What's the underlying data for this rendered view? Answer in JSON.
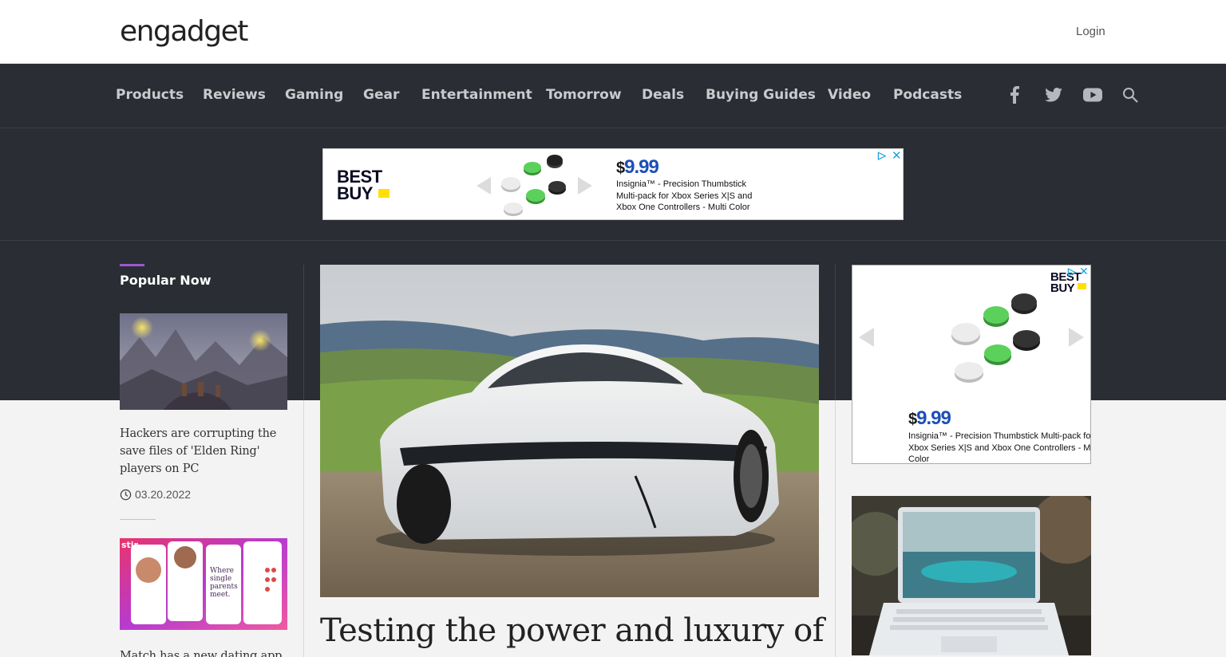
{
  "header": {
    "logo": "engadget",
    "login_label": "Login"
  },
  "nav": {
    "items": [
      {
        "label": "Products"
      },
      {
        "label": "Reviews"
      },
      {
        "label": "Gaming"
      },
      {
        "label": "Gear"
      },
      {
        "label": "Entertainment"
      },
      {
        "label": "Tomorrow"
      },
      {
        "label": "Deals"
      },
      {
        "label": "Buying Guides"
      },
      {
        "label": "Video"
      },
      {
        "label": "Podcasts"
      }
    ],
    "social_icons": [
      "facebook-icon",
      "twitter-icon",
      "youtube-icon",
      "search-icon"
    ]
  },
  "ad_banner": {
    "brand_line1": "BEST",
    "brand_line2": "BUY",
    "price_symbol": "$",
    "price_value": "9.99",
    "description_line1": "Insignia™ - Precision Thumbstick",
    "description_line2": "Multi-pack for Xbox Series X|S and",
    "description_line3": "Xbox One Controllers - Multi Color"
  },
  "ad_side": {
    "brand_line1": "BEST",
    "brand_line2": "BUY",
    "price_symbol": "$",
    "price_value": "9.99",
    "description_line1": "Insignia™ - Precision Thumbstick Multi-pack for",
    "description_line2": "Xbox Series X|S and Xbox One Controllers - Multi",
    "description_line3": "Color"
  },
  "popular": {
    "title": "Popular Now",
    "articles": [
      {
        "title_line1": "Hackers are corrupting the",
        "title_line2": "save files of 'Elden Ring'",
        "title_line3": "players on PC",
        "date": "03.20.2022"
      },
      {
        "title_line1": "Match has a new dating app"
      }
    ],
    "stir_brand": "stir",
    "stir_phone_text": "Where single parents meet."
  },
  "hero": {
    "title": "Testing the power and luxury of"
  },
  "colors": {
    "accent": "#9b59d0",
    "dark_bg": "#2a2d33",
    "bestbuy_yellow": "#ffe000",
    "price_blue": "#1d4fb8"
  }
}
